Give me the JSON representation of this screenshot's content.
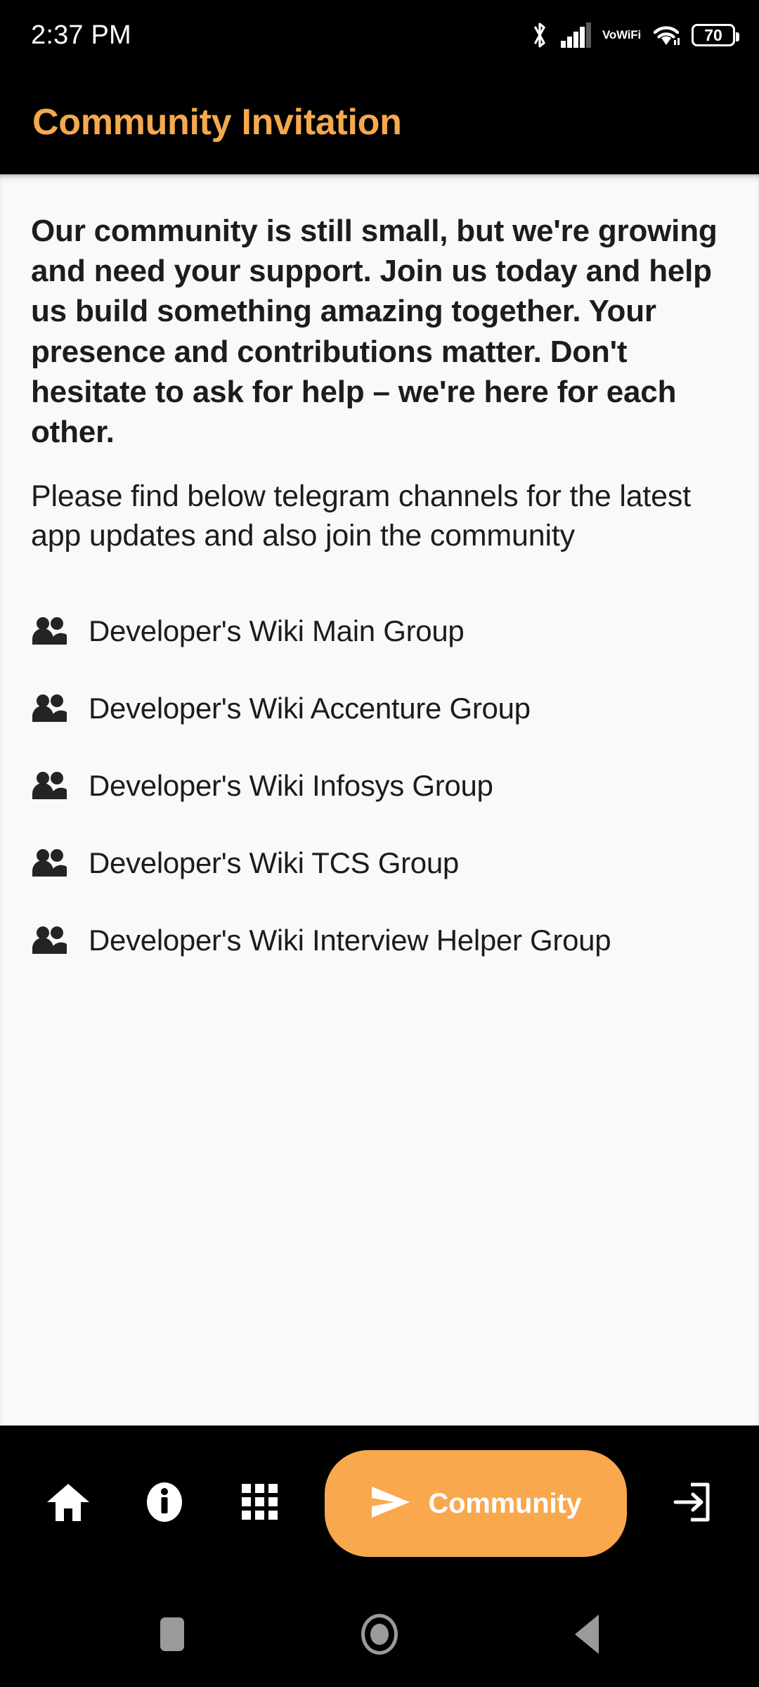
{
  "status_bar": {
    "time": "2:37 PM",
    "battery_level": "70",
    "vowifi_line1": "Vo",
    "vowifi_line2": "WiFi",
    "icons": [
      "bluetooth-icon",
      "cellular-signal-icon",
      "vowifi-indicator",
      "wifi-icon",
      "battery-icon"
    ]
  },
  "header": {
    "title": "Community Invitation",
    "title_color": "#F5A94E",
    "background_color": "#000000"
  },
  "main": {
    "background_color": "#F9F9F9",
    "lead_paragraph": "Our community is still small, but we're growing and need your support. Join us today and help us build something amazing together. Your presence and contributions matter. Don't hesitate to ask for help – we're here for each other.",
    "sub_paragraph": "Please find below telegram channels for the latest app updates and also join the community",
    "groups": [
      {
        "label": "Developer's Wiki Main Group",
        "icon": "people-group-icon"
      },
      {
        "label": "Developer's Wiki Accenture Group",
        "icon": "people-group-icon"
      },
      {
        "label": "Developer's Wiki Infosys Group",
        "icon": "people-group-icon"
      },
      {
        "label": "Developer's Wiki TCS Group",
        "icon": "people-group-icon"
      },
      {
        "label": "Developer's Wiki Interview Helper Group",
        "icon": "people-group-icon"
      }
    ]
  },
  "bottom_nav": {
    "background_color": "#000000",
    "accent_color": "#F9A84D",
    "items": [
      {
        "icon": "home-icon",
        "active": false
      },
      {
        "icon": "info-icon",
        "active": false
      },
      {
        "icon": "apps-grid-icon",
        "active": false
      },
      {
        "icon": "send-icon",
        "label": "Community",
        "active": true
      },
      {
        "icon": "exit-icon",
        "active": false
      }
    ],
    "active_label": "Community"
  },
  "system_nav": {
    "icon_color": "#9A9A9A",
    "buttons": [
      "recents-button",
      "home-button",
      "back-button"
    ]
  }
}
